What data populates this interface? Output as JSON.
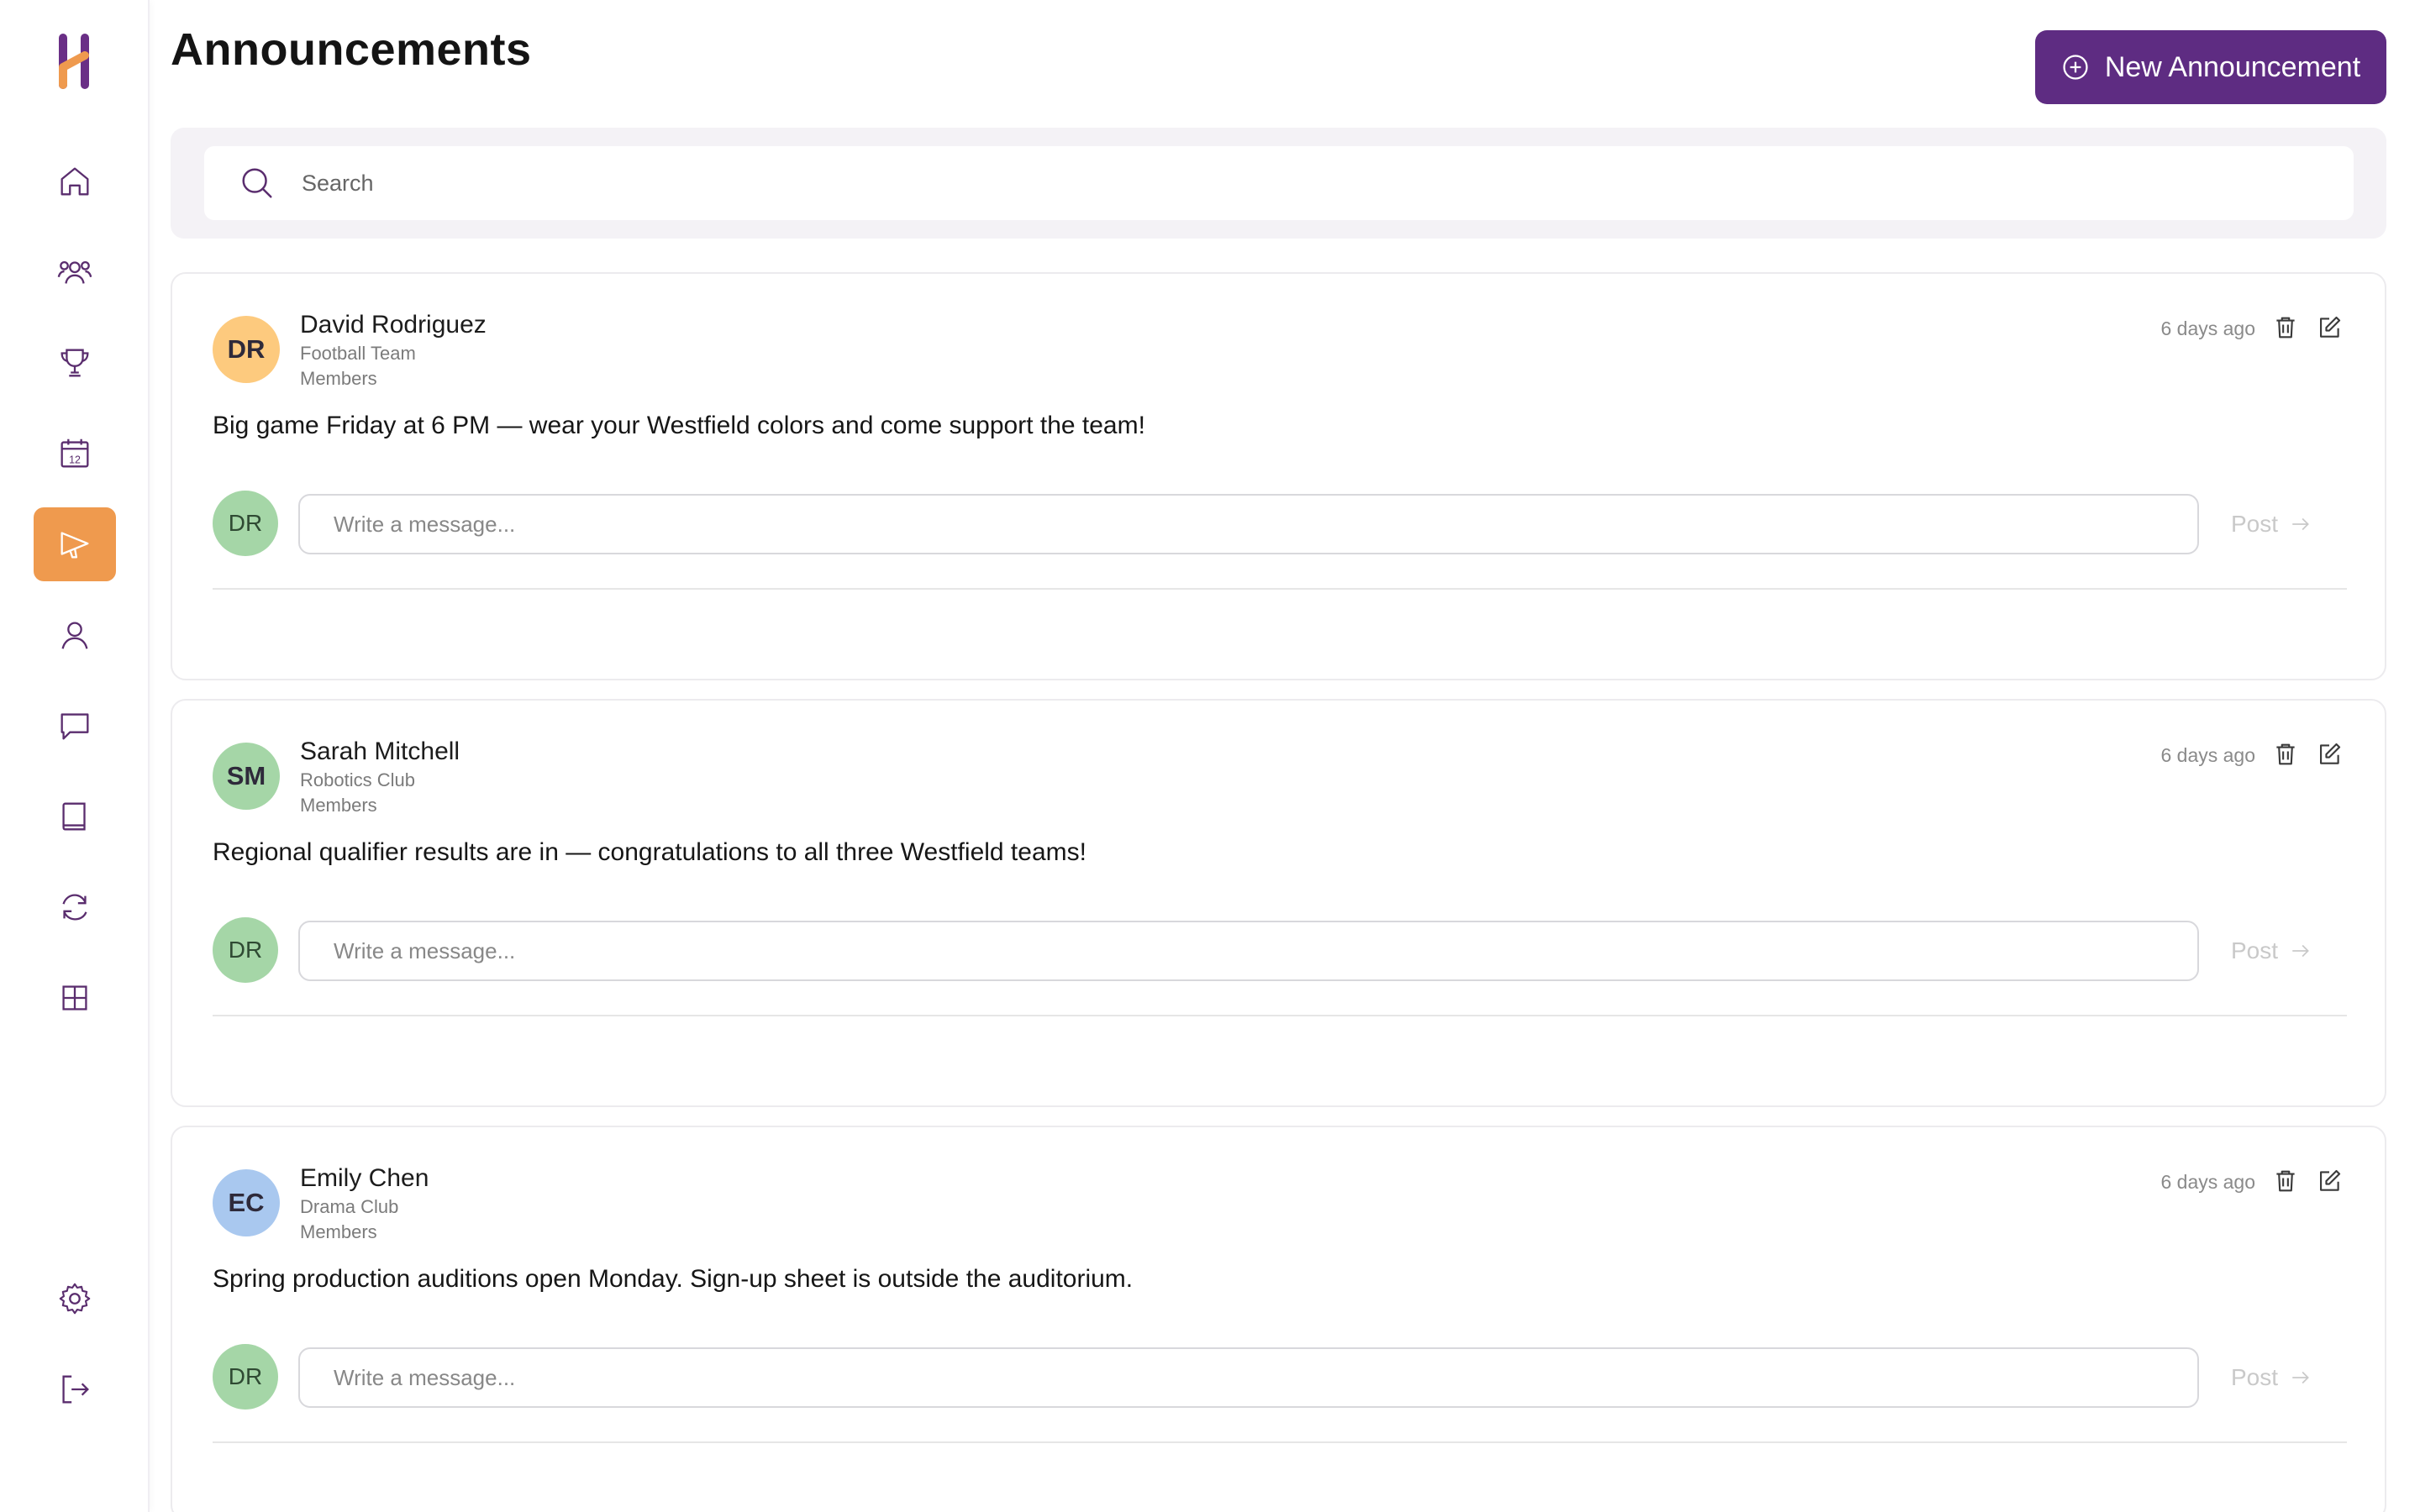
{
  "header": {
    "title": "Announcements",
    "new_button_label": "New Announcement"
  },
  "search": {
    "placeholder": "Search"
  },
  "sidebar": {
    "items": [
      {
        "name": "home",
        "icon": "home-icon",
        "active": false
      },
      {
        "name": "members",
        "icon": "users-icon",
        "active": false
      },
      {
        "name": "achievements",
        "icon": "trophy-icon",
        "active": false
      },
      {
        "name": "calendar",
        "icon": "calendar-icon",
        "active": false,
        "badge": "12"
      },
      {
        "name": "announcements",
        "icon": "megaphone-icon",
        "active": true
      },
      {
        "name": "profile",
        "icon": "user-icon",
        "active": false
      },
      {
        "name": "messages",
        "icon": "chat-icon",
        "active": false
      },
      {
        "name": "library",
        "icon": "book-icon",
        "active": false
      },
      {
        "name": "sync",
        "icon": "refresh-icon",
        "active": false
      },
      {
        "name": "dashboard",
        "icon": "grid-icon",
        "active": false
      },
      {
        "name": "settings",
        "icon": "gear-icon",
        "active": false
      },
      {
        "name": "logout",
        "icon": "logout-icon",
        "active": false
      }
    ]
  },
  "announcements": [
    {
      "initials": "DR",
      "avatar_color": "#fdca7e",
      "author": "David Rodriguez",
      "group": "Football Team",
      "role": "Members",
      "time": "6 days ago",
      "message": "Big game Friday at 6 PM — wear your Westfield colors and come support the team!",
      "commenter_initials": "DR",
      "comment_placeholder": "Write a message...",
      "post_label": "Post"
    },
    {
      "initials": "SM",
      "avatar_color": "#a5d6a7",
      "author": "Sarah Mitchell",
      "group": "Robotics Club",
      "role": "Members",
      "time": "6 days ago",
      "message": "Regional qualifier results are in — congratulations to all three Westfield teams!",
      "commenter_initials": "DR",
      "comment_placeholder": "Write a message...",
      "post_label": "Post"
    },
    {
      "initials": "EC",
      "avatar_color": "#a9c8ef",
      "author": "Emily Chen",
      "group": "Drama Club",
      "role": "Members",
      "time": "6 days ago",
      "message": "Spring production auditions open Monday. Sign-up sheet is outside the auditorium.",
      "commenter_initials": "DR",
      "comment_placeholder": "Write a message...",
      "post_label": "Post"
    }
  ],
  "colors": {
    "brand": "#5e2c82",
    "accent": "#ef9a4e",
    "icon": "#5a2d6e"
  }
}
